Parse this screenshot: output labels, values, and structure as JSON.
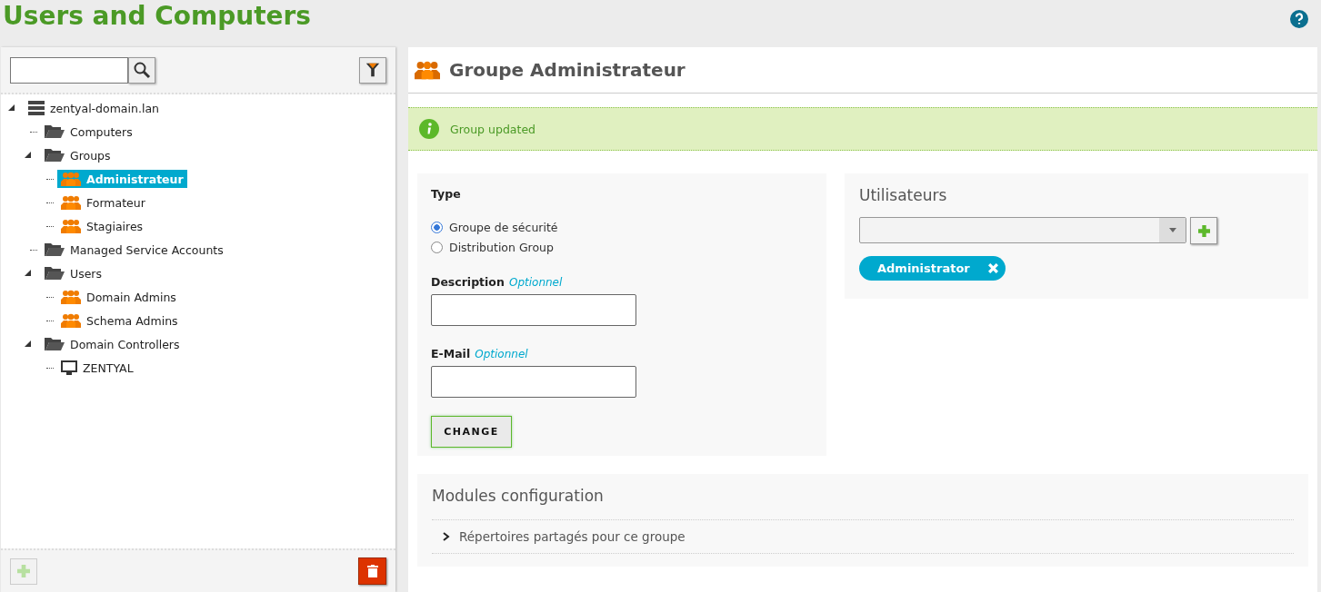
{
  "page_title": "Users and Computers",
  "tree": [
    {
      "label": "zentyal-domain.lan",
      "kind": "domain",
      "expanded": true,
      "selected": false,
      "children": [
        {
          "label": "Computers",
          "kind": "folder",
          "expanded": false,
          "selected": false
        },
        {
          "label": "Groups",
          "kind": "folder",
          "expanded": true,
          "selected": false,
          "children": [
            {
              "label": "Administrateur",
              "kind": "group",
              "selected": true
            },
            {
              "label": "Formateur",
              "kind": "group",
              "selected": false
            },
            {
              "label": "Stagiaires",
              "kind": "group",
              "selected": false
            }
          ]
        },
        {
          "label": "Managed Service Accounts",
          "kind": "folder",
          "expanded": false,
          "selected": false
        },
        {
          "label": "Users",
          "kind": "folder",
          "expanded": true,
          "selected": false,
          "children": [
            {
              "label": "Domain Admins",
              "kind": "group",
              "selected": false
            },
            {
              "label": "Schema Admins",
              "kind": "group",
              "selected": false
            }
          ]
        },
        {
          "label": "Domain Controllers",
          "kind": "folder",
          "expanded": true,
          "selected": false,
          "children": [
            {
              "label": "ZENTYAL",
              "kind": "computer",
              "selected": false
            }
          ]
        }
      ]
    }
  ],
  "detail": {
    "title": "Groupe Administrateur",
    "message": "Group updated",
    "type_label": "Type",
    "type_options": [
      {
        "label": "Groupe de sécurité",
        "selected": true
      },
      {
        "label": "Distribution Group",
        "selected": false
      }
    ],
    "fields": [
      {
        "label": "Description",
        "hint": "Optionnel"
      },
      {
        "label": "E-Mail",
        "hint": "Optionnel"
      }
    ],
    "submit": "CHANGE",
    "members_title": "Utilisateurs",
    "members": [
      "Administrator"
    ],
    "modules_title": "Modules configuration",
    "modules": [
      {
        "label": "Répertoires partagés pour ce groupe",
        "expanded": false
      }
    ]
  }
}
